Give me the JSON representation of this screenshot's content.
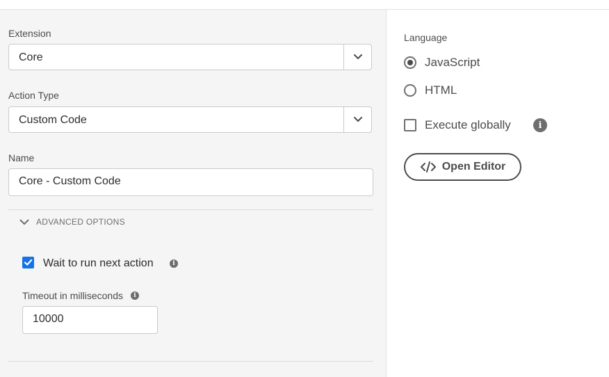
{
  "form": {
    "extension_label": "Extension",
    "extension_value": "Core",
    "action_type_label": "Action Type",
    "action_type_value": "Custom Code",
    "name_label": "Name",
    "name_value": "Core - Custom Code"
  },
  "advanced": {
    "toggle_label": "ADVANCED OPTIONS",
    "wait_label": "Wait to run next action",
    "wait_checked": true,
    "timeout_label": "Timeout in milliseconds",
    "timeout_value": "10000"
  },
  "language": {
    "label": "Language",
    "options": [
      "JavaScript",
      "HTML"
    ],
    "selected": "JavaScript",
    "execute_globally_label": "Execute globally",
    "execute_globally_checked": false,
    "open_editor_label": "Open Editor"
  },
  "icons": {
    "dropdown": "chevron-down-icon",
    "info": "info-icon",
    "code": "code-icon"
  },
  "colors": {
    "accent": "#1473e6",
    "panel_bg": "#f5f5f5",
    "text": "#2c2c2c"
  }
}
